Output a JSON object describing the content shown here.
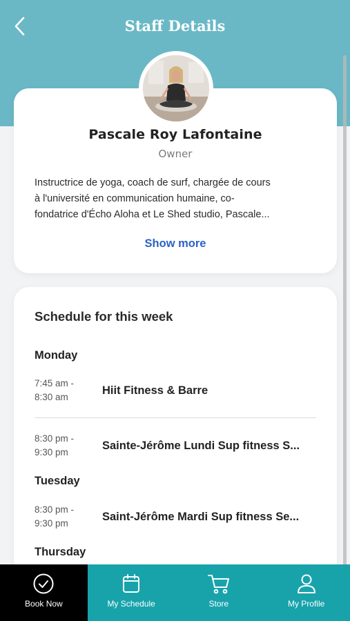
{
  "header": {
    "title": "Staff Details"
  },
  "staff": {
    "name": "Pascale Roy Lafontaine",
    "role": "Owner",
    "bio_lines": [
      "Instructrice de yoga, coach de surf, chargée de cours",
      "à l'université en communication humaine, co-",
      "fondatrice d'Écho Aloha et Le Shed studio, Pascale..."
    ],
    "show_more_label": "Show more"
  },
  "schedule": {
    "title": "Schedule for this week",
    "days": [
      {
        "day": "Monday",
        "classes": [
          {
            "start": "7:45 am -",
            "end": "8:30 am",
            "name": "Hiit Fitness & Barre"
          },
          {
            "start": "8:30 pm -",
            "end": "9:30 pm",
            "name": "Sainte-Jérôme Lundi Sup fitness S..."
          }
        ]
      },
      {
        "day": "Tuesday",
        "classes": [
          {
            "start": "8:30 pm -",
            "end": "9:30 pm",
            "name": "Saint-Jérôme Mardi Sup fitness Se..."
          }
        ]
      },
      {
        "day": "Thursday",
        "classes": []
      }
    ]
  },
  "tabbar": {
    "tabs": [
      {
        "label": "Book Now",
        "icon": "check-circle-icon"
      },
      {
        "label": "My Schedule",
        "icon": "calendar-icon"
      },
      {
        "label": "Store",
        "icon": "cart-icon"
      },
      {
        "label": "My Profile",
        "icon": "person-icon"
      }
    ]
  },
  "colors": {
    "header": "#6ab8c6",
    "tabbar": "#18a3ab",
    "active_tab": "#000000",
    "link": "#2a63c4"
  }
}
